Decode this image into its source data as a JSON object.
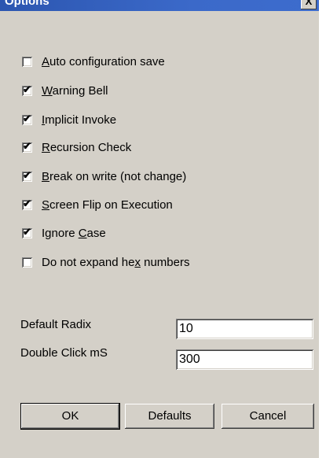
{
  "window": {
    "title": "Options",
    "close_glyph": "X"
  },
  "checkboxes": [
    {
      "pre": "",
      "key": "A",
      "post": "uto configuration save",
      "checked": false
    },
    {
      "pre": "",
      "key": "W",
      "post": "arning Bell",
      "checked": true
    },
    {
      "pre": "",
      "key": "I",
      "post": "mplicit Invoke",
      "checked": true
    },
    {
      "pre": "",
      "key": "R",
      "post": "ecursion Check",
      "checked": true
    },
    {
      "pre": "",
      "key": "B",
      "post": "reak on write (not change)",
      "checked": true
    },
    {
      "pre": "",
      "key": "S",
      "post": "creen Flip on Execution",
      "checked": true
    },
    {
      "pre": "Ignore ",
      "key": "C",
      "post": "ase",
      "checked": true
    },
    {
      "pre": "Do not expand he",
      "key": "x",
      "post": " numbers",
      "checked": false
    }
  ],
  "fields": {
    "default_radix": {
      "label": "Default Radix",
      "value": "10"
    },
    "double_click": {
      "label": "Double Click mS",
      "value": "300"
    }
  },
  "buttons": {
    "ok": "OK",
    "defaults": "Defaults",
    "cancel": "Cancel"
  },
  "check_mark": "✔"
}
